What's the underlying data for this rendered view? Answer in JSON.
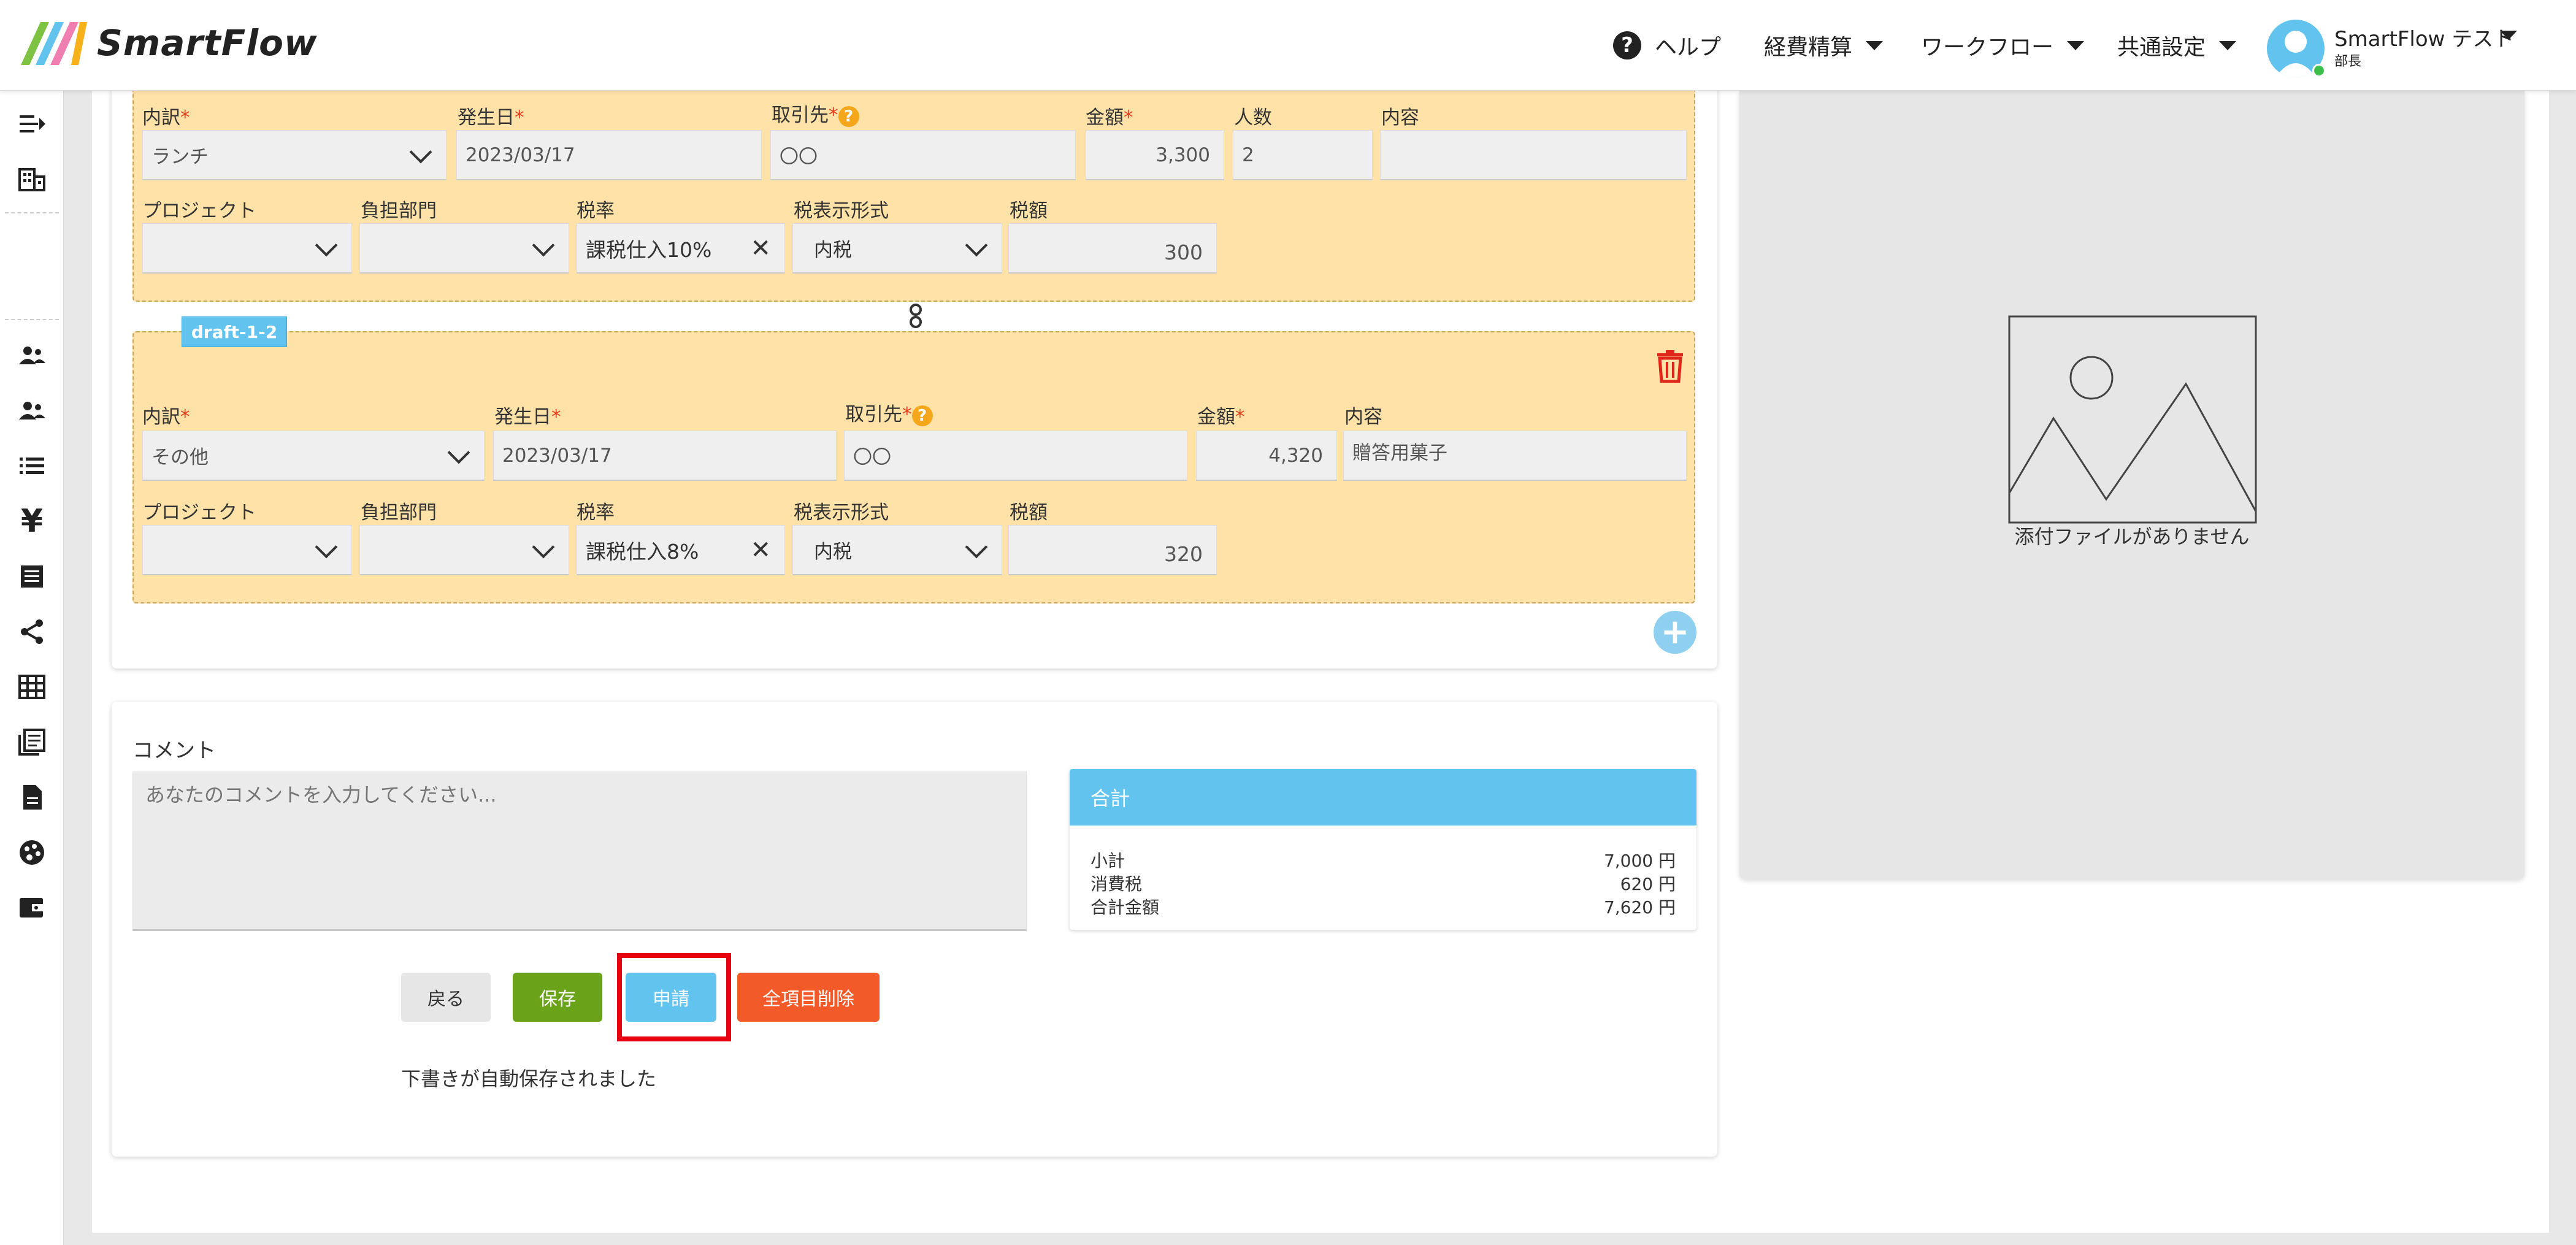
{
  "app": {
    "brand": "SmartFlow"
  },
  "header": {
    "nav": [
      {
        "label": "ヘルプ"
      },
      {
        "label": "経費精算"
      },
      {
        "label": "ワークフロー"
      },
      {
        "label": "共通設定"
      }
    ],
    "user": {
      "name": "SmartFlow テスト",
      "role": "部長"
    }
  },
  "sidebar": {
    "icons": [
      "collapse-menu-icon",
      "company-icon",
      "users-icon",
      "user-group-icon",
      "list-icon",
      "yen-icon",
      "receipt-icon",
      "share-icon",
      "table-icon",
      "document-list-icon",
      "file-icon",
      "palette-icon",
      "wallet-icon"
    ]
  },
  "expense_lines": [
    {
      "tag": "",
      "labels": {
        "breakdown": "内訳",
        "date": "発生日",
        "vendor": "取引先",
        "amount": "金額",
        "people": "人数",
        "content": "内容",
        "project": "プロジェクト",
        "department": "負担部門",
        "tax_rate": "税率",
        "tax_display": "税表示形式",
        "tax": "税額"
      },
      "breakdown": "ランチ",
      "date": "2023/03/17",
      "vendor": "〇〇",
      "amount": "3,300",
      "people": "2",
      "content": "",
      "project": "",
      "department": "",
      "tax_rate": "課税仕入10%",
      "tax_display": "内税",
      "tax": "300"
    },
    {
      "tag": "draft-1-2",
      "labels": {
        "breakdown": "内訳",
        "date": "発生日",
        "vendor": "取引先",
        "amount": "金額",
        "content": "内容",
        "project": "プロジェクト",
        "department": "負担部門",
        "tax_rate": "税率",
        "tax_display": "税表示形式",
        "tax": "税額"
      },
      "breakdown": "その他",
      "date": "2023/03/17",
      "vendor": "〇〇",
      "amount": "4,320",
      "content": "贈答用菓子",
      "project": "",
      "department": "",
      "tax_rate": "課税仕入8%",
      "tax_display": "内税",
      "tax": "320"
    }
  ],
  "comment": {
    "label": "コメント",
    "placeholder": "あなたのコメントを入力してください..."
  },
  "summary": {
    "title": "合計",
    "rows": [
      {
        "label": "小計",
        "value": "7,000 円"
      },
      {
        "label": "消費税",
        "value": "620 円"
      },
      {
        "label": "合計金額",
        "value": "7,620 円"
      }
    ]
  },
  "buttons": {
    "back": "戻る",
    "save": "保存",
    "apply": "申請",
    "delete_all": "全項目削除"
  },
  "status": {
    "autosave": "下書きが自動保存されました"
  },
  "attachment": {
    "empty": "添付ファイルがありません"
  },
  "colors": {
    "accent": "#62c3ef",
    "save": "#6aa31a",
    "delete": "#f25a2a",
    "highlight": "#e60012",
    "line_bg": "#ffe2a8"
  }
}
